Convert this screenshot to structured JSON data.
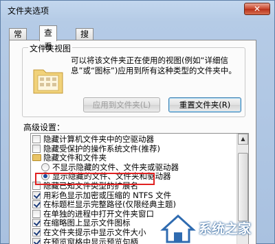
{
  "window": {
    "title": "文件夹选项",
    "close_label": "✕"
  },
  "tabs": [
    {
      "label": "常规",
      "active": false
    },
    {
      "label": "查看",
      "active": true
    },
    {
      "label": "搜索",
      "active": false
    }
  ],
  "folder_views": {
    "legend": "文件夹视图",
    "description": "可以将该文件夹正在使用的视图(例如“详细信息”或“图标”)应用到所有这种类型的文件夹中。",
    "apply_button": "应用到文件夹(L)",
    "reset_button": "重置文件夹(R)"
  },
  "advanced": {
    "label": "高级设置：",
    "items": [
      {
        "kind": "checkbox",
        "checked": false,
        "indent": 0,
        "label": "隐藏计算机文件夹中的空驱动器"
      },
      {
        "kind": "checkbox",
        "checked": false,
        "indent": 0,
        "label": "隐藏受保护的操作系统文件(推荐)"
      },
      {
        "kind": "folder",
        "indent": 0,
        "label": "隐藏文件和文件夹"
      },
      {
        "kind": "radio",
        "checked": false,
        "indent": 1,
        "label": "不显示隐藏的文件、文件夹或驱动器"
      },
      {
        "kind": "radio",
        "checked": true,
        "indent": 1,
        "label": "显示隐藏的文件、文件夹和驱动器"
      },
      {
        "kind": "checkbox",
        "checked": false,
        "indent": 0,
        "label": "隐藏已知文件类型的扩展名"
      },
      {
        "kind": "checkbox",
        "checked": true,
        "indent": 0,
        "label": "用彩色显示加密或压缩的 NTFS 文件"
      },
      {
        "kind": "checkbox",
        "checked": true,
        "indent": 0,
        "label": "在标题栏显示完整路径(仅限经典主题)"
      },
      {
        "kind": "checkbox",
        "checked": false,
        "indent": 0,
        "label": "在单独的进程中打开文件夹窗口"
      },
      {
        "kind": "checkbox",
        "checked": true,
        "indent": 0,
        "label": "在缩略图上显示文件图标"
      },
      {
        "kind": "checkbox",
        "checked": true,
        "indent": 0,
        "label": "在文件夹提示中显示文件大小"
      },
      {
        "kind": "checkbox",
        "checked": true,
        "indent": 0,
        "label": "在预览窗格中显示预览句柄"
      }
    ]
  },
  "watermark": {
    "text": "系统之家"
  }
}
